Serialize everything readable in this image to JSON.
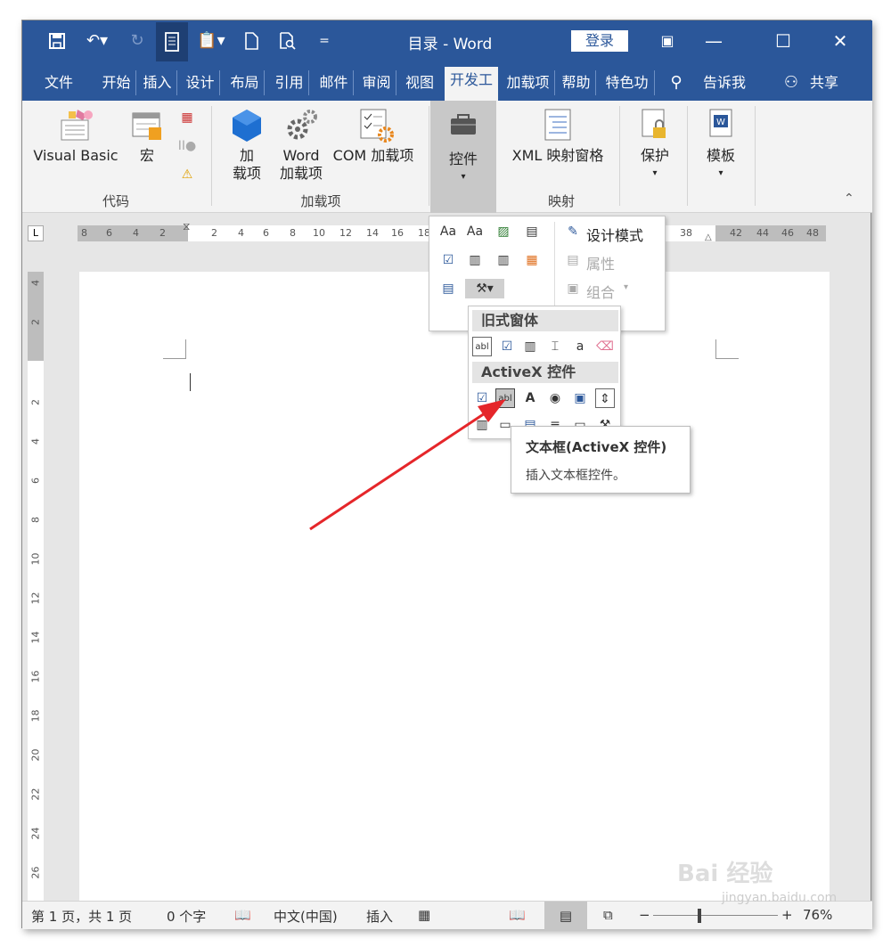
{
  "titlebar": {
    "title": "目录  -  Word",
    "login": "登录"
  },
  "tabs": [
    "文件",
    "开始",
    "插入",
    "设计",
    "布局",
    "引用",
    "邮件",
    "审阅",
    "视图",
    "开发工",
    "加载项",
    "帮助",
    "特色功",
    "告诉我",
    "共享"
  ],
  "ribbon": {
    "visual_basic": "Visual Basic",
    "macros": "宏",
    "addins_line1": "加",
    "addins_line2": "载项",
    "word_addins_line1": "Word",
    "word_addins_line2": "加载项",
    "com_addins": "COM 加载项",
    "controls": "控件",
    "xml_mapping": "XML 映射窗格",
    "protect": "保护",
    "template": "模板",
    "group_code": "代码",
    "group_addins": "加载项",
    "group_mapping": "映射"
  },
  "ruler_h": [
    "8",
    "6",
    "4",
    "2",
    "2",
    "4",
    "6",
    "8",
    "10",
    "12",
    "14",
    "16",
    "18",
    "38",
    "42",
    "44",
    "46",
    "48"
  ],
  "ruler_v": [
    "4",
    "2",
    "2",
    "4",
    "6",
    "8",
    "10",
    "12",
    "14",
    "16",
    "18",
    "20",
    "22",
    "24",
    "26"
  ],
  "controls_popup": {
    "design_mode": "设计模式",
    "properties": "属性",
    "group": "组合"
  },
  "legacy": {
    "legacy_forms": "旧式窗体",
    "activex": "ActiveX 控件"
  },
  "tooltip": {
    "title": "文本框(ActiveX 控件)",
    "description": "插入文本框控件。"
  },
  "status": {
    "page": "第 1 页，共 1 页",
    "words": "0 个字",
    "language": "中文(中国)",
    "mode": "插入",
    "zoom": "76%"
  },
  "watermark": {
    "logo": "Bai 经验",
    "url": "jingyan.baidu.com"
  },
  "colors": {
    "accent": "#2b579a",
    "arrow": "#e5262a"
  }
}
